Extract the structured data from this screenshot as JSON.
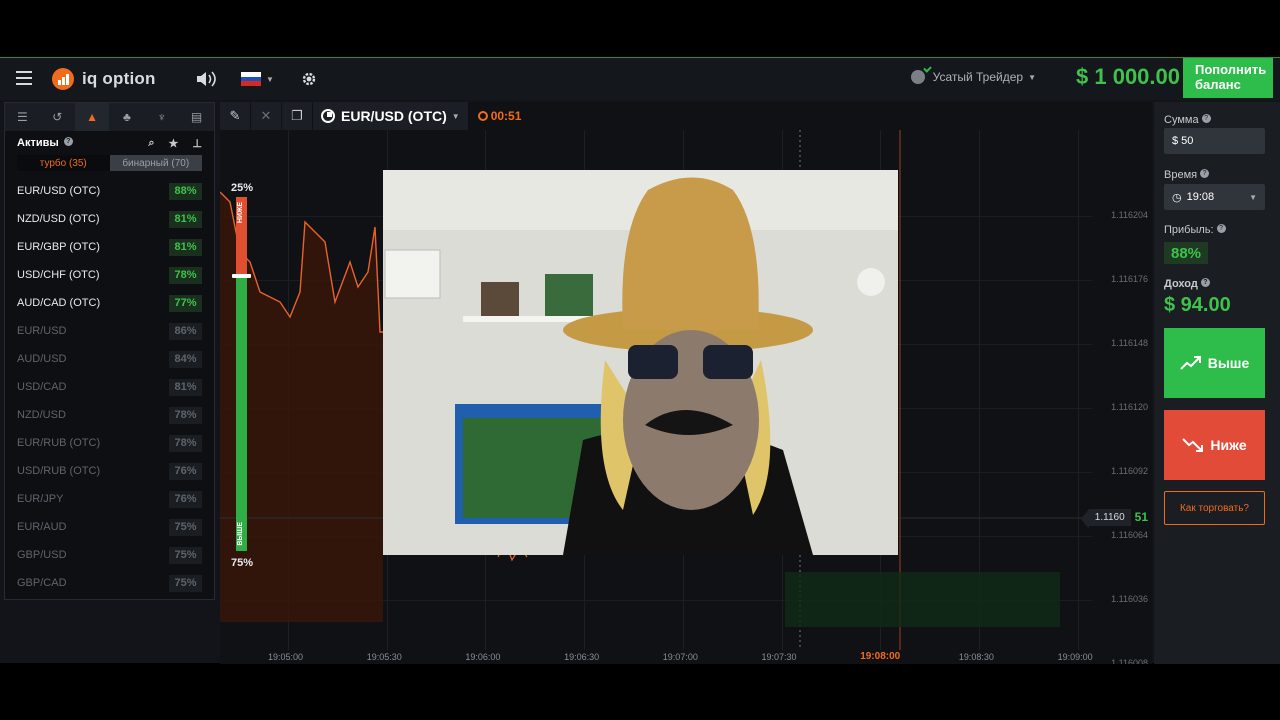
{
  "header": {
    "logo_text": "iq option",
    "user_name": "Усатый Трейдер",
    "balance": "$ 1 000.00",
    "deposit_label": "Пополнить баланс",
    "icons": [
      "menu-icon",
      "sound-icon",
      "flag-ru-icon",
      "settings-icon"
    ]
  },
  "sidebar": {
    "assets_title": "Активы",
    "seg_turbo": "турбо (35)",
    "seg_binary": "бинарный (70)",
    "assets": [
      {
        "name": "EUR/USD (OTC)",
        "pct": "88%",
        "active": true
      },
      {
        "name": "NZD/USD (OTC)",
        "pct": "81%",
        "active": true
      },
      {
        "name": "EUR/GBP (OTC)",
        "pct": "81%",
        "active": true
      },
      {
        "name": "USD/CHF (OTC)",
        "pct": "78%",
        "active": true
      },
      {
        "name": "AUD/CAD (OTC)",
        "pct": "77%",
        "active": true
      },
      {
        "name": "EUR/USD",
        "pct": "86%",
        "active": false
      },
      {
        "name": "AUD/USD",
        "pct": "84%",
        "active": false
      },
      {
        "name": "USD/CAD",
        "pct": "81%",
        "active": false
      },
      {
        "name": "NZD/USD",
        "pct": "78%",
        "active": false
      },
      {
        "name": "EUR/RUB (OTC)",
        "pct": "78%",
        "active": false
      },
      {
        "name": "USD/RUB (OTC)",
        "pct": "76%",
        "active": false
      },
      {
        "name": "EUR/JPY",
        "pct": "76%",
        "active": false
      },
      {
        "name": "EUR/AUD",
        "pct": "75%",
        "active": false
      },
      {
        "name": "GBP/USD",
        "pct": "75%",
        "active": false
      },
      {
        "name": "GBP/CAD",
        "pct": "75%",
        "active": false
      }
    ]
  },
  "chart": {
    "asset": "EUR/USD (OTC)",
    "timer": "00:51",
    "pct_top": "25%",
    "pct_bottom": "75%",
    "label_down": "НИЖЕ",
    "label_up": "ВЫШЕ",
    "price_labels": [
      "1.116204",
      "1.116176",
      "1.116148",
      "1.116120",
      "1.116092",
      "1.116064",
      "1.116036",
      "1.116008"
    ],
    "time_labels": [
      "19:05:00",
      "19:05:30",
      "19:06:00",
      "19:06:30",
      "19:07:00",
      "19:07:30",
      "19:08:00",
      "19:08:30",
      "19:09:00"
    ],
    "current_price": "1.1160",
    "current_price_big": "51",
    "accent_color": "#f26b1d"
  },
  "panel": {
    "amount_label": "Сумма",
    "amount_value": "$  50",
    "time_label": "Время",
    "time_value": "19:08",
    "profit_label": "Прибыль:",
    "profit_value": "88%",
    "income_label": "Доход",
    "income_value": "$ 94.00",
    "up_label": "Выше",
    "down_label": "Ниже",
    "how_label": "Как торговать?"
  }
}
